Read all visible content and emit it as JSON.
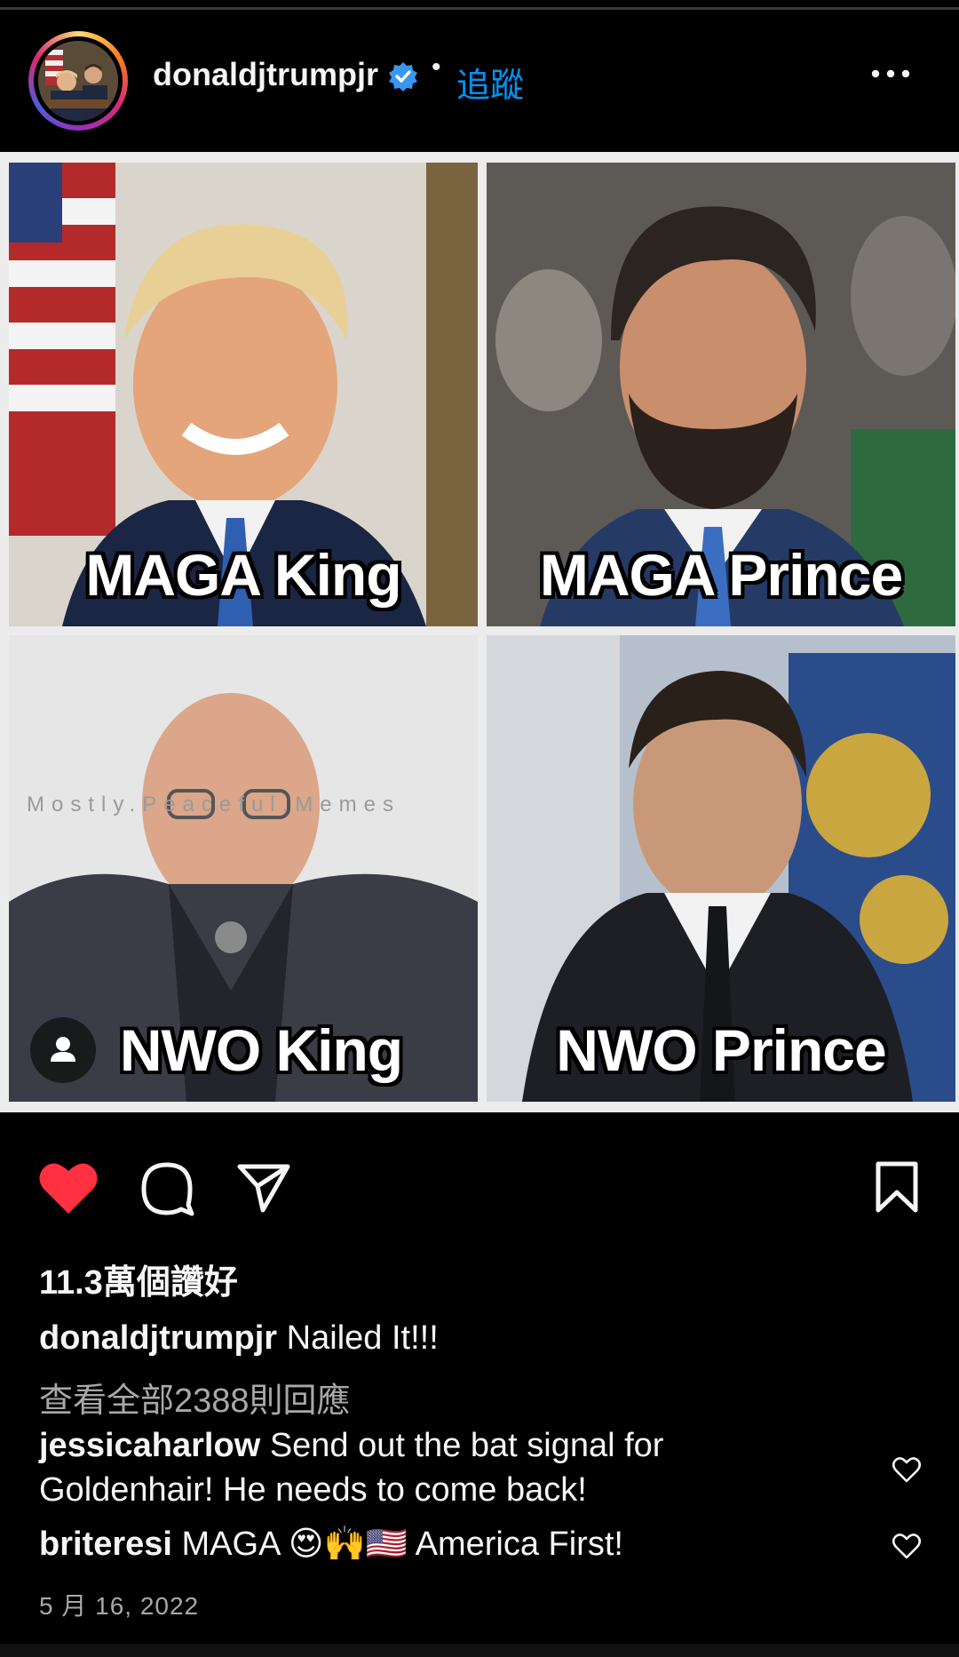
{
  "header": {
    "username": "donaldjtrumpjr",
    "separator": "•",
    "follow_label": "追蹤",
    "verified_icon": "verified-badge-icon",
    "more_icon": "more-options-icon",
    "accent_color": "#0095f6"
  },
  "post": {
    "tiles": [
      {
        "caption": "MAGA King"
      },
      {
        "caption": "MAGA Prince"
      },
      {
        "caption": "NWO King"
      },
      {
        "caption": "NWO Prince"
      }
    ],
    "watermark": "Mostly.Peaceful.Memes",
    "tag_icon": "user-tag-icon"
  },
  "actions": {
    "like_icon": "heart-filled-icon",
    "comment_icon": "comment-icon",
    "share_icon": "send-icon",
    "save_icon": "bookmark-icon",
    "like_color": "#ff3040"
  },
  "likes_text": "11.3萬個讚好",
  "caption": {
    "username": "donaldjtrumpjr",
    "text": "Nailed It!!!"
  },
  "view_all_comments": "查看全部2388則回應",
  "comments": [
    {
      "username": "jessicaharlow",
      "text": "Send out the bat signal for Goldenhair! He needs to come back!"
    },
    {
      "username": "briteresi",
      "text": "MAGA 😍🙌🇺🇸 America First!"
    }
  ],
  "date": "5 月 16, 2022"
}
